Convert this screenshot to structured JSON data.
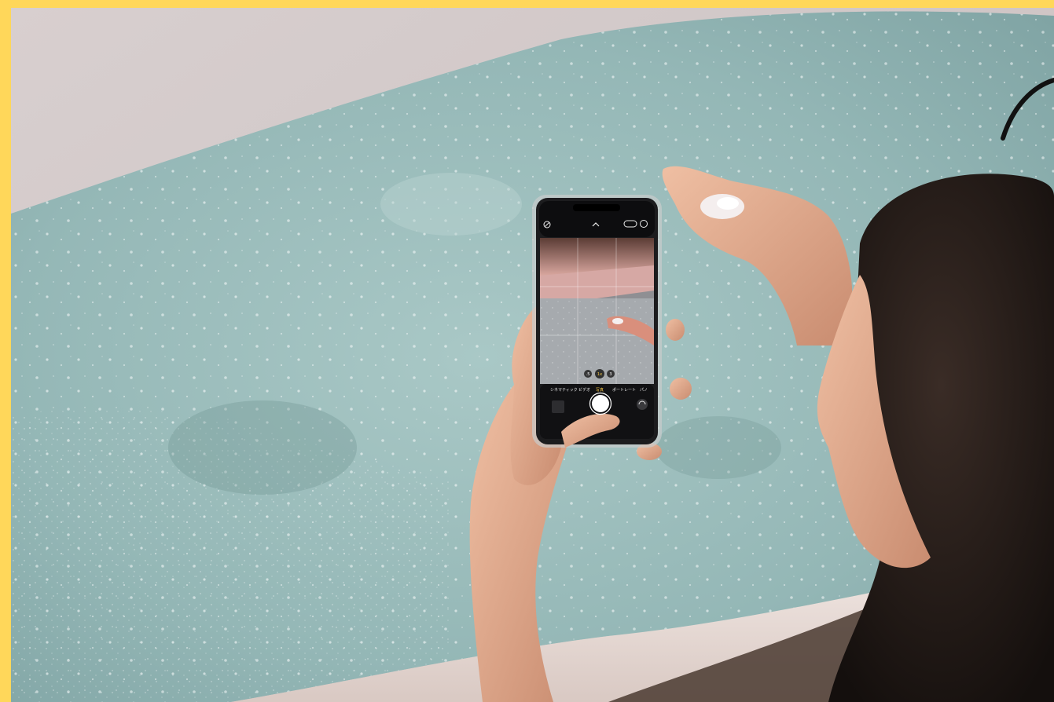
{
  "photo": {
    "subject": "woman-photographing-bath-with-smartphone",
    "colors": {
      "border": "#FFD75A",
      "water": "#8fb4b3",
      "tub_rim": "#e6dcd9",
      "skin": "#e4a88a",
      "hair": "#1e1714",
      "phone": "#1c1c1e"
    }
  },
  "camera_app": {
    "modes": [
      "シネマティック",
      "ビデオ",
      "写真",
      "ポートレート",
      "パノ"
    ],
    "active_mode": "写真",
    "zoom_levels": [
      ".5",
      "1x",
      "3"
    ],
    "icons": [
      "flash-off-icon",
      "chevron-up-icon",
      "live-photo-icon",
      "settings-icon",
      "shutter-button",
      "thumbnail",
      "flip-camera-icon"
    ]
  }
}
